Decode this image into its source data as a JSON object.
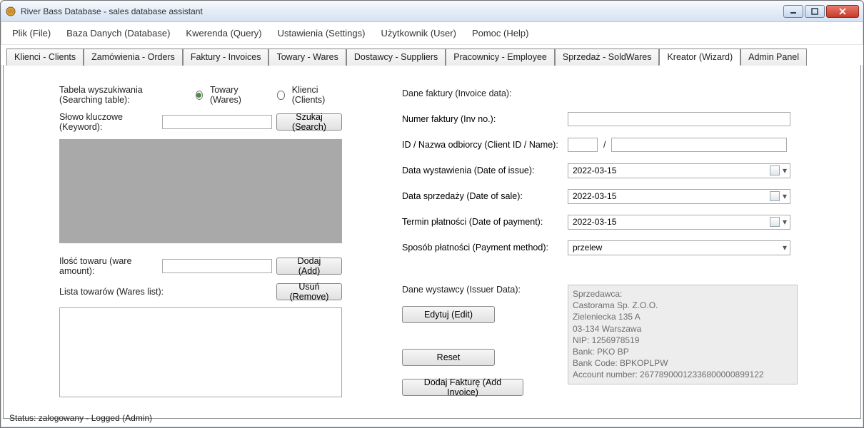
{
  "titlebar": {
    "title": "River Bass Database - sales database assistant"
  },
  "menu": {
    "items": [
      "Plik (File)",
      "Baza Danych (Database)",
      "Kwerenda (Query)",
      "Ustawienia (Settings)",
      "Użytkownik (User)",
      "Pomoc (Help)"
    ]
  },
  "tabs": [
    "Klienci - Clients",
    "Zamówienia - Orders",
    "Faktury - Invoices",
    "Towary - Wares",
    "Dostawcy - Suppliers",
    "Pracownicy - Employee",
    "Sprzedaż - SoldWares",
    "Kreator (Wizard)",
    "Admin Panel"
  ],
  "tabs_active_index": 7,
  "left": {
    "searching_table_label": "Tabela wyszukiwania (Searching table):",
    "radio_wares": "Towary (Wares)",
    "radio_clients": "Klienci (Clients)",
    "radio_selected": "wares",
    "keyword_label": "Słowo kluczowe (Keyword):",
    "keyword_value": "",
    "search_btn": "Szukaj (Search)",
    "amount_label": "Ilość towaru (ware amount):",
    "amount_value": "",
    "add_btn": "Dodaj (Add)",
    "list_label": "Lista towarów (Wares list):",
    "remove_btn": "Usuń (Remove)"
  },
  "right": {
    "invoice_data_label": "Dane faktury (Invoice data):",
    "inv_no_label": "Numer faktury (Inv no.):",
    "inv_no_value": "",
    "client_id_label": "ID / Nazwa odbiorcy (Client ID / Name):",
    "client_id_value": "",
    "client_name_value": "",
    "slash": "/",
    "date_issue_label": "Data wystawienia (Date of issue):",
    "date_issue_value": "2022-03-15",
    "date_sale_label": "Data sprzedaży (Date of sale):",
    "date_sale_value": "2022-03-15",
    "date_payment_label": "Termin płatności (Date of payment):",
    "date_payment_value": "2022-03-15",
    "pay_method_label": "Sposób płatności (Payment method):",
    "pay_method_value": "przelew",
    "issuer_label": "Dane wystawcy (Issuer Data):",
    "edit_btn": "Edytuj (Edit)",
    "reset_btn": "Reset",
    "add_invoice_btn": "Dodaj Fakturę (Add Invoice)",
    "issuer_box": {
      "l1": "Sprzedawca:",
      "l2": "Castorama Sp. Z.O.O.",
      "l3": "Zieleniecka 135 A",
      "l4": "03-134 Warszawa",
      "l5": "NIP: 1256978519",
      "l6": "Bank: PKO BP",
      "l7": "Bank Code: BPKOPLPW",
      "l8": "Account number: 26778900012336800000899122"
    }
  },
  "status": {
    "text": "Status: zalogowany - Logged (Admin)"
  }
}
